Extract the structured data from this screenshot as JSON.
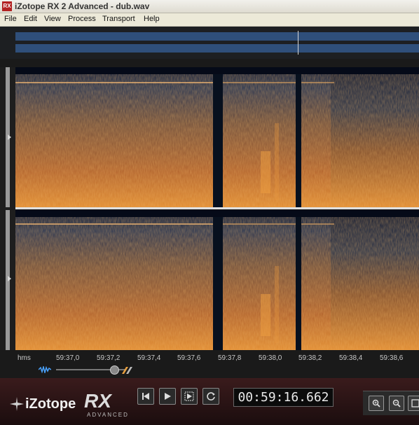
{
  "window": {
    "title": "iZotope RX 2 Advanced - dub.wav",
    "app_icon_label": "RX"
  },
  "menubar": {
    "items": [
      "File",
      "Edit",
      "View",
      "Process",
      "Transport",
      "Help"
    ]
  },
  "time_axis": {
    "unit": "hms",
    "ticks": [
      "59:37,0",
      "59:37,2",
      "59:37,4",
      "59:37,6",
      "59:37,8",
      "59:38,0",
      "59:38,2",
      "59:38,4",
      "59:38,6"
    ]
  },
  "branding": {
    "brand": "iZotope",
    "product": "RX",
    "edition": "ADVANCED"
  },
  "transport": {
    "timecode": "00:59:16.662",
    "buttons": [
      "go-to-start",
      "play",
      "play-selection",
      "loop"
    ]
  },
  "view_buttons": [
    "zoom-in",
    "zoom-out",
    "zoom-fit"
  ],
  "colors": {
    "spectrogram_low": "#0a1530",
    "spectrogram_mid": "#8a4a1e",
    "spectrogram_high": "#f0a040",
    "accent_red": "#6a1a1c"
  }
}
